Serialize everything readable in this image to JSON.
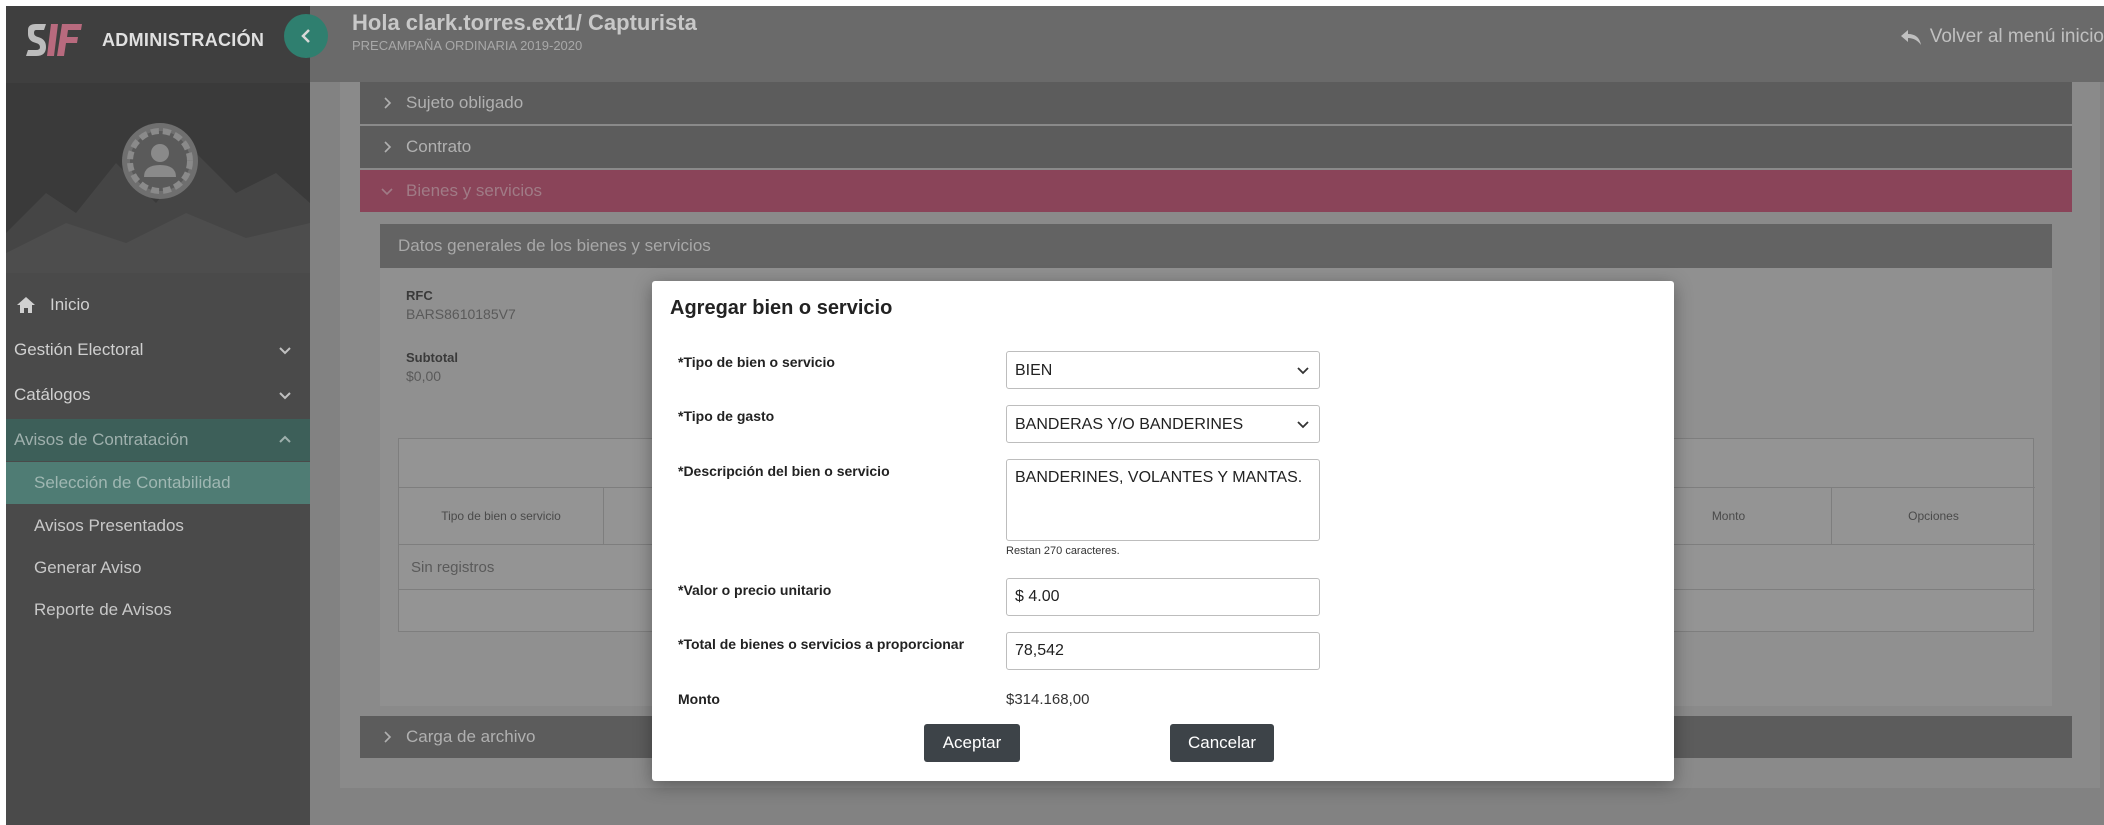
{
  "sidebar": {
    "brand_title": "ADMINISTRACIÓN",
    "menu": {
      "home": "Inicio",
      "electoral": "Gestión Electoral",
      "catalogs": "Catálogos",
      "contract_notices": "Avisos de Contratación"
    },
    "submenu": [
      "Selección de Contabilidad",
      "Avisos Presentados",
      "Generar Aviso",
      "Reporte de Avisos"
    ]
  },
  "header": {
    "greeting": "Hola clark.torres.ext1/ Capturista",
    "process": "PRECAMPAÑA ORDINARIA 2019-2020",
    "back_link": "Volver al menú inicio"
  },
  "accordion": {
    "sujeto": "Sujeto obligado",
    "contrato": "Contrato",
    "bienes": "Bienes y servicios",
    "carga": "Carga de archivo"
  },
  "card": {
    "title": "Datos generales de los bienes y servicios",
    "rfc_label": "RFC",
    "rfc_value": "BARS8610185V7",
    "subtotal_label": "Subtotal",
    "subtotal_value": "$0,00",
    "table": {
      "headers": [
        "Tipo de bien o servicio",
        "Monto",
        "Opciones"
      ],
      "empty": "Sin registros"
    }
  },
  "modal": {
    "title": "Agregar bien o servicio",
    "tipo_bien_label": "*Tipo de bien o servicio",
    "tipo_bien_value": "BIEN",
    "tipo_gasto_label": "*Tipo de gasto",
    "tipo_gasto_value": "BANDERAS Y/O BANDERINES",
    "descripcion_label": "*Descripción del bien o servicio",
    "descripcion_value": "BANDERINES, VOLANTES Y MANTAS.",
    "chars_left": "Restan 270 caracteres.",
    "valor_label": "*Valor o precio unitario",
    "valor_value": "$ 4.00",
    "total_label": "*Total de bienes o servicios a proporcionar",
    "total_value": "78,542",
    "monto_label": "Monto",
    "monto_value": "$314.168,00",
    "accept": "Aceptar",
    "cancel": "Cancelar"
  },
  "colors": {
    "accent_teal": "#2f7f6f",
    "accent_pink": "#8a4459",
    "button_dark": "#3d4348"
  }
}
